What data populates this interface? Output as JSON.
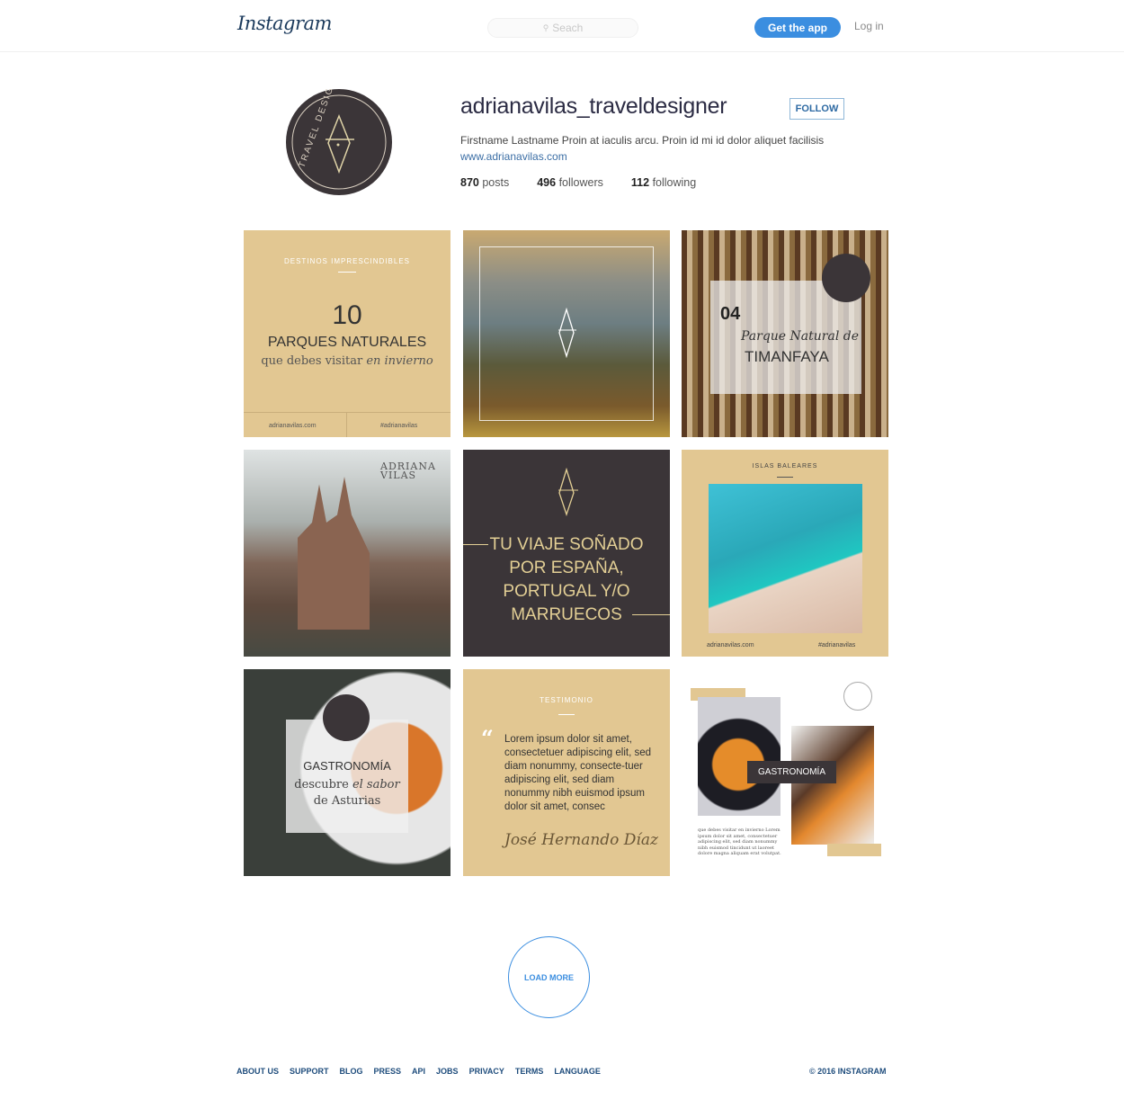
{
  "header": {
    "logo": "Instagram",
    "search_placeholder": "Seach",
    "search_icon": "search-icon",
    "get_app": "Get the app",
    "login": "Log in"
  },
  "profile": {
    "username": "adrianavilas_traveldesigner",
    "follow": "FOLLOW",
    "bio": "Firstname Lastname Proin at iaculis arcu. Proin id mi id dolor aliquet facilisis",
    "website": "www.adrianavilas.com",
    "avatar_text": "TRAVEL DESIGNER",
    "stats": [
      {
        "value": "870",
        "label": "posts"
      },
      {
        "value": "496",
        "label": "followers"
      },
      {
        "value": "112",
        "label": "following"
      }
    ]
  },
  "posts": {
    "p1": {
      "kicker": "DESTINOS IMPRESCINDIBLES",
      "number": "10",
      "title": "PARQUES NATURALES",
      "sub_a": "que debes visitar ",
      "sub_b": "en invierno",
      "left": "adrianavilas.com",
      "right": "#adrianavilas"
    },
    "p3": {
      "number": "04",
      "line1": "Parque Natural de",
      "line2": "TIMANFAYA"
    },
    "p4": {
      "brand1": "ADRIANA",
      "brand2": "VILAS"
    },
    "p5": {
      "lines": [
        "TU VIAJE SOÑADO",
        "POR ESPAÑA,",
        "PORTUGAL Y/O",
        "MARRUECOS"
      ]
    },
    "p6": {
      "kicker": "ISLAS BALEARES",
      "left": "adrianavilas.com",
      "right": "#adrianavilas"
    },
    "p7": {
      "title": "GASTRONOMÍA",
      "line1a": "descubre ",
      "line1b": "el sabor",
      "line2": "de Asturias"
    },
    "p8": {
      "kicker": "TESTIMONIO",
      "quote_mark": "66",
      "quote": "Lorem ipsum dolor sit amet, consectetuer adipiscing elit, sed diam nonummy, consecte-tuer adipiscing elit, sed diam nonummy nibh euismod ipsum dolor sit amet, consec",
      "signature": "José Hernando Díaz"
    },
    "p9": {
      "label": "GASTRONOMÍA",
      "caption": "que debes visitar en invierno Lorem ipsum dolor sit amet, consectetuer adipiscing elit, sed diam nonummy nibh euismod tincidunt ut laoreet dolore magna aliquam erat volutpat."
    }
  },
  "load_more": "LOAD MORE",
  "footer": {
    "links": [
      "ABOUT US",
      "SUPPORT",
      "BLOG",
      "PRESS",
      "API",
      "JOBS",
      "PRIVACY",
      "TERMS",
      "LANGUAGE"
    ],
    "copyright": "© 2016 INSTAGRAM"
  },
  "colors": {
    "accent": "#3b8ee0",
    "gold": "#e2c792",
    "dark": "#3b3538",
    "link": "#1e4c7c"
  }
}
